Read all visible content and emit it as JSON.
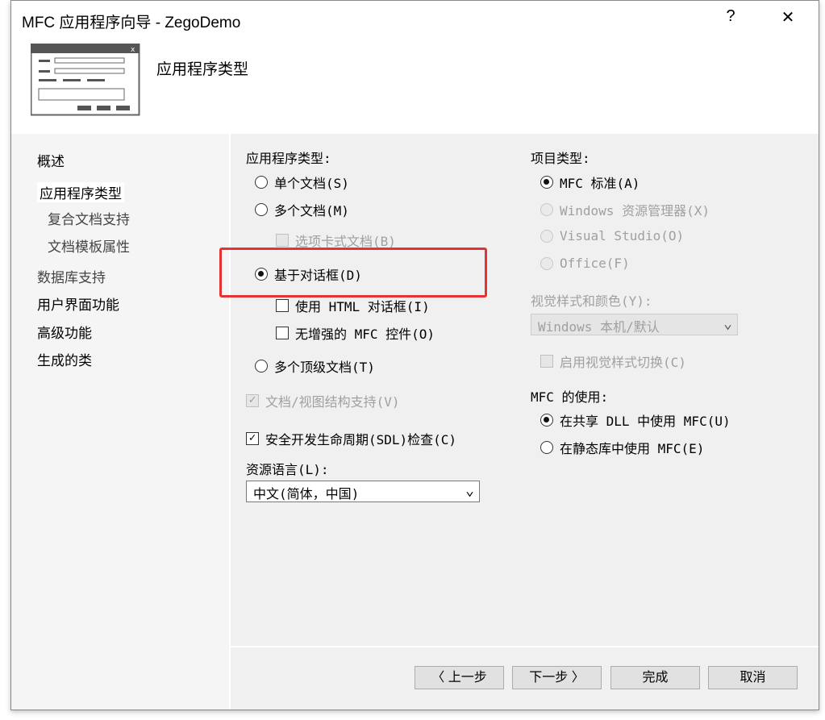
{
  "window": {
    "title": "MFC 应用程序向导 - ZegoDemo",
    "help": "?",
    "close": "✕"
  },
  "header": {
    "title": "应用程序类型"
  },
  "nav": [
    "概述",
    "应用程序类型",
    "复合文档支持",
    "文档模板属性",
    "数据库支持",
    "用户界面功能",
    "高级功能",
    "生成的类"
  ],
  "left": {
    "app_type_label": "应用程序类型:",
    "single": "单个文档(S)",
    "multi": "多个文档(M)",
    "tabbed": "选项卡式文档(B)",
    "dialog": "基于对话框(D)",
    "html_dialog": "使用 HTML 对话框(I)",
    "no_enhanced": "无增强的 MFC 控件(O)",
    "multi_top": "多个顶级文档(T)",
    "docview": "文档/视图结构支持(V)",
    "sdl": "安全开发生命周期(SDL)检查(C)",
    "lang_label": "资源语言(L):",
    "lang_value": "中文(简体，中国)"
  },
  "right": {
    "project_type_label": "项目类型:",
    "mfc_std": "MFC 标准(A)",
    "explorer": "Windows 资源管理器(X)",
    "vs": "Visual Studio(O)",
    "office": "Office(F)",
    "style_label": "视觉样式和颜色(Y):",
    "style_value": "Windows 本机/默认",
    "style_switch": "启用视觉样式切换(C)",
    "mfc_use_label": "MFC 的使用:",
    "shared": "在共享 DLL 中使用 MFC(U)",
    "static": "在静态库中使用 MFC(E)"
  },
  "buttons": {
    "prev": "〈 上一步",
    "next": "下一步 〉",
    "finish": "完成",
    "cancel": "取消"
  }
}
